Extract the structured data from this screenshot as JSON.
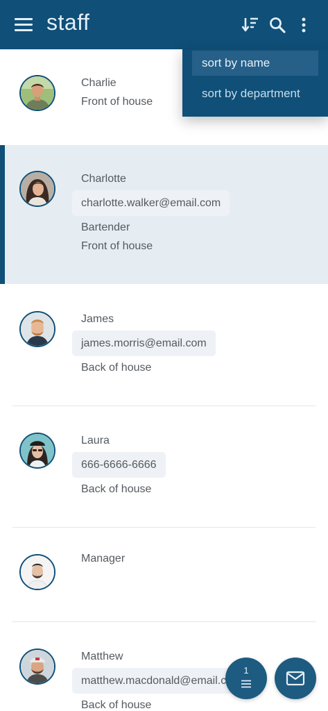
{
  "app": {
    "title": "staff"
  },
  "sort_menu": {
    "items": [
      "sort by name",
      "sort by department"
    ],
    "active_index": 0
  },
  "staff": [
    {
      "name": "Charlie",
      "details": [
        "Front of house"
      ]
    },
    {
      "name": "Charlotte",
      "email": "charlotte.walker@email.com",
      "details": [
        "Bartender",
        "Front of house"
      ],
      "selected": true
    },
    {
      "name": "James",
      "email": "james.morris@email.com",
      "details": [
        "Back of house"
      ]
    },
    {
      "name": "Laura",
      "phone": "666-6666-6666",
      "details": [
        "Back of house"
      ]
    },
    {
      "name": "Manager"
    },
    {
      "name": "Matthew",
      "email": "matthew.macdonald@email.com",
      "details": [
        "Back of house"
      ]
    }
  ],
  "fab": {
    "filter_count": "1"
  },
  "colors": {
    "primary": "#0f4f78",
    "selected_row": "#e5edf2",
    "chip": "#eef2f6",
    "text": "#555a5f"
  }
}
